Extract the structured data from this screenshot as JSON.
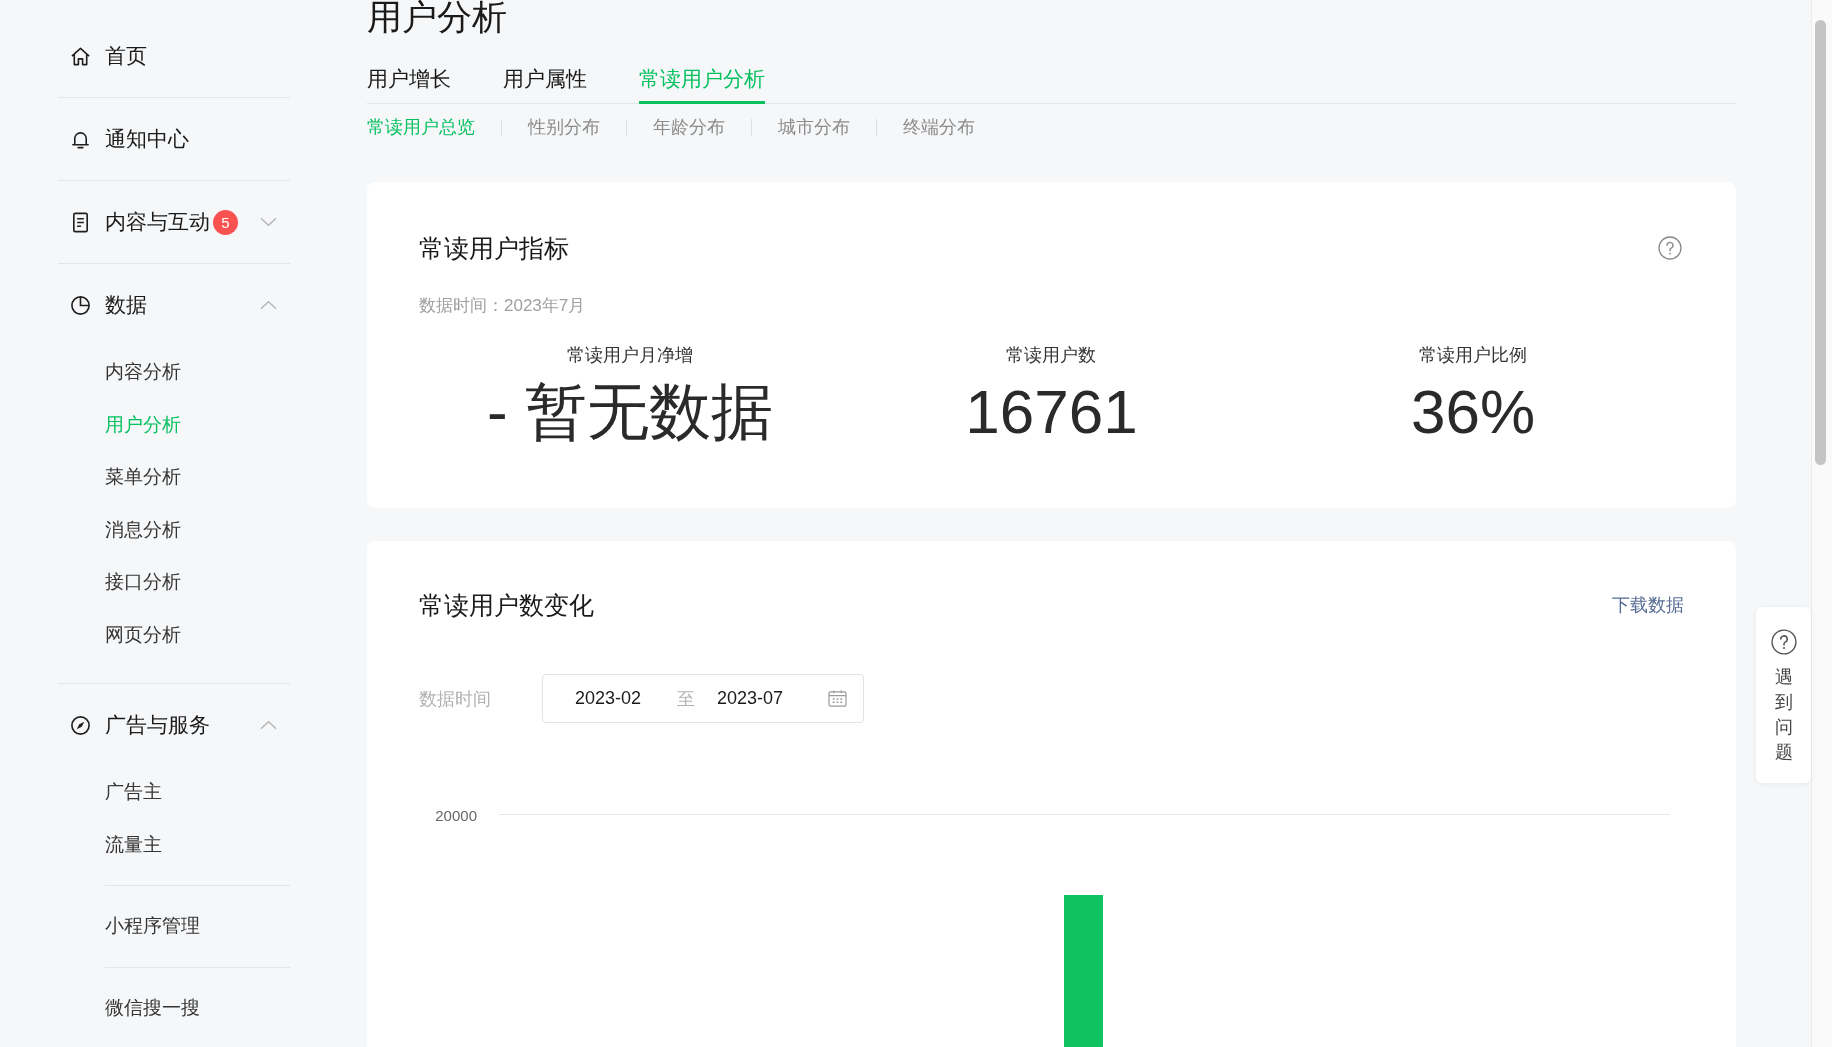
{
  "page_title": "用户分析",
  "sidebar": {
    "items": [
      {
        "kind": "link",
        "label": "首页",
        "selected": false
      },
      {
        "kind": "link",
        "label": "通知中心",
        "selected": false
      },
      {
        "kind": "group",
        "label": "内容与互动",
        "badge": "5",
        "selected": false,
        "expanded": false
      },
      {
        "kind": "group",
        "label": "数据",
        "selected": false,
        "expanded": true,
        "children": [
          {
            "items": [
              {
                "label": "内容分析",
                "selected": false
              },
              {
                "label": "用户分析",
                "selected": true
              },
              {
                "label": "菜单分析",
                "selected": false
              },
              {
                "label": "消息分析",
                "selected": false
              },
              {
                "label": "接口分析",
                "selected": false
              },
              {
                "label": "网页分析",
                "selected": false
              }
            ]
          }
        ]
      },
      {
        "kind": "group",
        "label": "广告与服务",
        "selected": false,
        "expanded": true,
        "children": [
          {
            "items": [
              {
                "label": "广告主",
                "selected": false
              },
              {
                "label": "流量主",
                "selected": false
              }
            ]
          },
          {
            "items": [
              {
                "label": "小程序管理",
                "selected": false
              }
            ]
          },
          {
            "items": [
              {
                "label": "微信搜一搜",
                "selected": false
              }
            ]
          }
        ]
      }
    ]
  },
  "tabs": [
    {
      "label": "用户增长",
      "selected": false
    },
    {
      "label": "用户属性",
      "selected": false
    },
    {
      "label": "常读用户分析",
      "selected": true
    }
  ],
  "sub_tabs": [
    {
      "label": "常读用户总览",
      "selected": true
    },
    {
      "label": "性别分布",
      "selected": false
    },
    {
      "label": "年龄分布",
      "selected": false
    },
    {
      "label": "城市分布",
      "selected": false
    },
    {
      "label": "终端分布",
      "selected": false
    }
  ],
  "metrics_card": {
    "title": "常读用户指标",
    "data_time": "数据时间：2023年7月",
    "metrics": [
      {
        "label": "常读用户月净增",
        "value": "- 暂无数据"
      },
      {
        "label": "常读用户数",
        "value": "16761"
      },
      {
        "label": "常读用户比例",
        "value": "36%"
      }
    ]
  },
  "trend_card": {
    "title": "常读用户数变化",
    "download_link": "下载数据",
    "date_label": "数据时间",
    "date_range": {
      "start": "2023-02",
      "separator": "至",
      "end": "2023-07"
    },
    "chart": {
      "y_tick": "20000"
    }
  },
  "help_button": {
    "label": "遇到问题"
  }
}
